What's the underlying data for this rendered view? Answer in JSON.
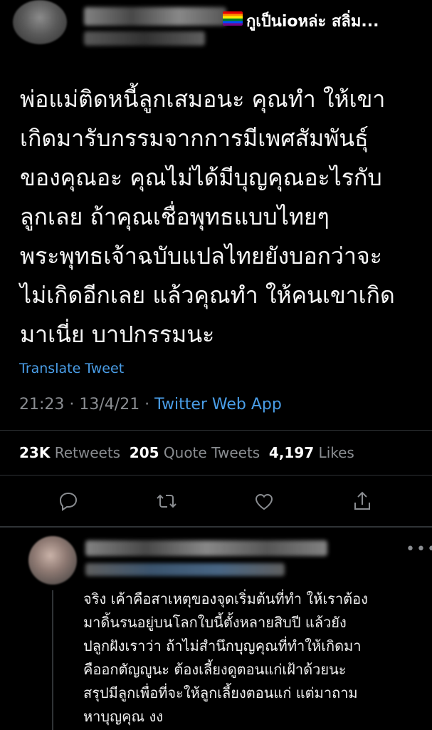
{
  "header": {
    "display_name": "กูเป็นioหล่ะ สลิ่ม...",
    "flag_icon": "rainbow-flag-icon"
  },
  "tweet": {
    "lines": [
      "พ่อแม่ติดหนี้ลูกเสมอนะ คุณทำ ให้เขา",
      "เกิดมารับกรรมจากการมีเพศสัมพันธุ์",
      "ของคุณอะ คุณไม่ได้มีบุญคุณอะไรกับ",
      "ลูกเลย ถ้าคุณเชื่อพุทธแบบไทยๆ",
      "พระพุทธเจ้าฉบับแปลไทยยังบอกว่าจะ",
      "ไม่เกิดอีกเลย แล้วคุณทำ ให้คนเขาเกิด",
      "มาเนี่ย บาปกรรมนะ"
    ],
    "translate_label": "Translate Tweet",
    "timestamp": "21:23 · 13/4/21 · ",
    "source_app": "Twitter Web App"
  },
  "stats": {
    "retweets_count": "23K",
    "retweets_label": "Retweets",
    "quotes_count": "205",
    "quotes_label": "Quote Tweets",
    "likes_count": "4,197",
    "likes_label": "Likes"
  },
  "actions": [
    "reply-icon",
    "retweet-icon",
    "like-icon",
    "share-icon"
  ],
  "reply": {
    "lines": [
      "จริง เค้าคือสาเหตุของจุดเริ่มต้นที่ทำ ให้เราต้อง",
      "มาดิ้นรนอยู่บนโลกใบนี้ตั้งหลายสิบปี แล้วยัง",
      "ปลูกฝังเราว่า ถ้าไม่สำนึกบุญคุณที่ทำให้เกิดมา",
      "คืออกตัญญูนะ ต้องเลี้ยงดูตอนแก่เฝ้าด้วยนะ",
      "สรุปมีลูกเพื่อที่จะให้ลูกเลี้ยงตอนแก่ แต่มาถาม",
      "หาบุญคุณ งง"
    ]
  },
  "colors": {
    "background": "#000000",
    "link": "#4a9ee8",
    "muted": "#8a8d91",
    "divider": "#2f3336"
  }
}
